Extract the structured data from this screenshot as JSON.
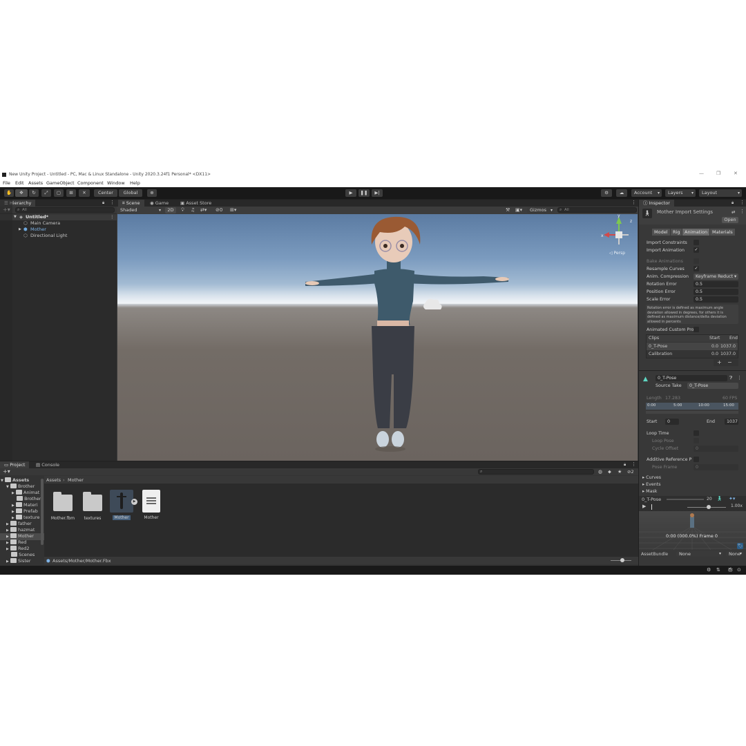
{
  "window": {
    "title": "New Unity Project - Untitled - PC, Mac & Linux Standalone - Unity 2020.3.24f1 Personal* <DX11>",
    "controls": [
      "—",
      "❐",
      "✕"
    ]
  },
  "menu": [
    "File",
    "Edit",
    "Assets",
    "GameObject",
    "Component",
    "Window",
    "Help"
  ],
  "toolbar": {
    "pivot": "Center",
    "space": "Global",
    "account": "Account",
    "layers": "Layers",
    "layout": "Layout"
  },
  "hierarchy": {
    "tab": "Hierarchy",
    "search_placeholder": "All",
    "scene": "Untitled*",
    "items": [
      "Main Camera",
      "Mother",
      "Directional Light"
    ]
  },
  "scene": {
    "tabs": [
      "Scene",
      "Game",
      "Asset Store"
    ],
    "shading": "Shaded",
    "mode_2d": "2D",
    "hidden_count": "0",
    "gizmos": "Gizmos",
    "search_placeholder": "All",
    "persp": "◁ Persp"
  },
  "inspector": {
    "tab": "Inspector",
    "title": "Mother Import Settings",
    "open_btn": "Open",
    "tabs": [
      "Model",
      "Rig",
      "Animation",
      "Materials"
    ],
    "import_constraints": "Import Constraints",
    "import_animation": "Import Animation",
    "bake_animations": "Bake Animations",
    "resample_curves": "Resample Curves",
    "anim_compression": "Anim. Compression",
    "anim_compression_value": "Keyframe Reduct",
    "rotation_error": "Rotation Error",
    "rotation_error_value": "0.5",
    "position_error": "Position Error",
    "position_error_value": "0.5",
    "scale_error": "Scale Error",
    "scale_error_value": "0.5",
    "help_text": "Rotation error is defined as maximum angle deviation allowed in degrees, for others it is defined as maximum distance/delta deviation allowed in percents",
    "animated_custom": "Animated Custom Pro",
    "clips_header": "Clips",
    "clips_start": "Start",
    "clips_end": "End",
    "clips": [
      {
        "name": "0_T-Pose",
        "start": "0.0",
        "end": "1037.0"
      },
      {
        "name": "Calibration",
        "start": "0.0",
        "end": "1037.0"
      }
    ],
    "clip_name": "0_T-Pose",
    "source_take": "Source Take",
    "source_take_value": "0_T-Pose",
    "length_label": "Length",
    "length_value": "17.283",
    "fps": "60 FPS",
    "timeline_ticks": [
      "0:00",
      "5:00",
      "10:00",
      "15:00"
    ],
    "start_label": "Start",
    "start_value": "0",
    "end_label": "End",
    "end_value": "1037",
    "loop_time": "Loop Time",
    "loop_pose": "Loop Pose",
    "cycle_offset": "Cycle Offset",
    "cycle_offset_value": "0",
    "additive_ref": "Additive Reference P",
    "pose_frame": "Pose Frame",
    "pose_frame_value": "0",
    "foldouts": [
      "Curves",
      "Events",
      "Mask"
    ],
    "preview_clip": "0_T-Pose",
    "preview_speed_num": "20",
    "preview_speed": "1.00x",
    "preview_time": "0:00 (000.0%) Frame 0",
    "assetbundle_label": "AssetBundle",
    "assetbundle_value": "None",
    "assetbundle_variant": "None"
  },
  "project": {
    "tabs": [
      "Project",
      "Console"
    ],
    "breadcrumb_root": "Assets",
    "breadcrumb_current": "Mother",
    "hidden_count": "2",
    "tree": [
      {
        "label": "Assets",
        "depth": 0,
        "open": true
      },
      {
        "label": "Brother",
        "depth": 1,
        "open": true
      },
      {
        "label": "Animat",
        "depth": 2,
        "open": false
      },
      {
        "label": "Brother",
        "depth": 2,
        "open": null
      },
      {
        "label": "Materi",
        "depth": 2,
        "open": false
      },
      {
        "label": "Prefab",
        "depth": 2,
        "open": false
      },
      {
        "label": "texture",
        "depth": 2,
        "open": false
      },
      {
        "label": "father",
        "depth": 1,
        "open": false
      },
      {
        "label": "hazmat",
        "depth": 1,
        "open": false
      },
      {
        "label": "Mother",
        "depth": 1,
        "open": false,
        "selected": true
      },
      {
        "label": "Red",
        "depth": 1,
        "open": false
      },
      {
        "label": "Red2",
        "depth": 1,
        "open": false
      },
      {
        "label": "Scenes",
        "depth": 1,
        "open": null
      },
      {
        "label": "Sister",
        "depth": 1,
        "open": false
      }
    ],
    "assets": [
      "Mother.fbm",
      "textures",
      "Mother",
      "Mother"
    ],
    "path": "Assets/Mother/Mother.Fbx"
  },
  "colors": {
    "accent": "#2c5d87",
    "selected": "#46607c",
    "mother_text": "#7fb3e6"
  }
}
